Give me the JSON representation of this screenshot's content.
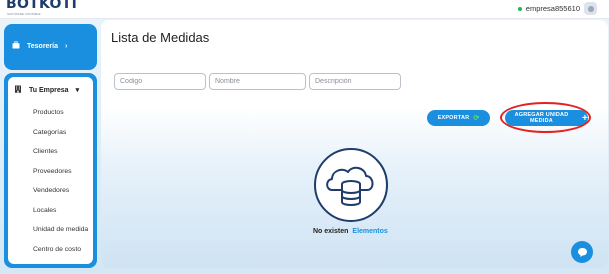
{
  "brand": {
    "logo": "BOTKOTI",
    "tagline": "SOFTWARE CONTABLE"
  },
  "user": {
    "name": "empresa855610"
  },
  "sidebar": {
    "top_item": {
      "label": "Tesorería",
      "icon": "briefcase-icon"
    },
    "section": {
      "label": "Tu Empresa",
      "icon": "building-icon",
      "items": [
        {
          "label": "Productos"
        },
        {
          "label": "Categorías"
        },
        {
          "label": "Clientes"
        },
        {
          "label": "Proveedores"
        },
        {
          "label": "Vendedores"
        },
        {
          "label": "Locales"
        },
        {
          "label": "Unidad de medida"
        },
        {
          "label": "Centro de costo"
        }
      ]
    }
  },
  "main": {
    "title": "Lista de Medidas",
    "filters": {
      "codigo_placeholder": "Codigo",
      "nombre_placeholder": "Nombre",
      "descripcion_placeholder": "Descripción"
    },
    "buttons": {
      "export_label": "EXPORTAR",
      "add_label": "AGREGAR UNIDAD MEDIDA"
    },
    "empty_state": {
      "text": "No existen",
      "accent": "Elementos"
    }
  },
  "colors": {
    "accent": "#1a8fe0",
    "highlight": "#e32222",
    "online": "#1db954"
  }
}
